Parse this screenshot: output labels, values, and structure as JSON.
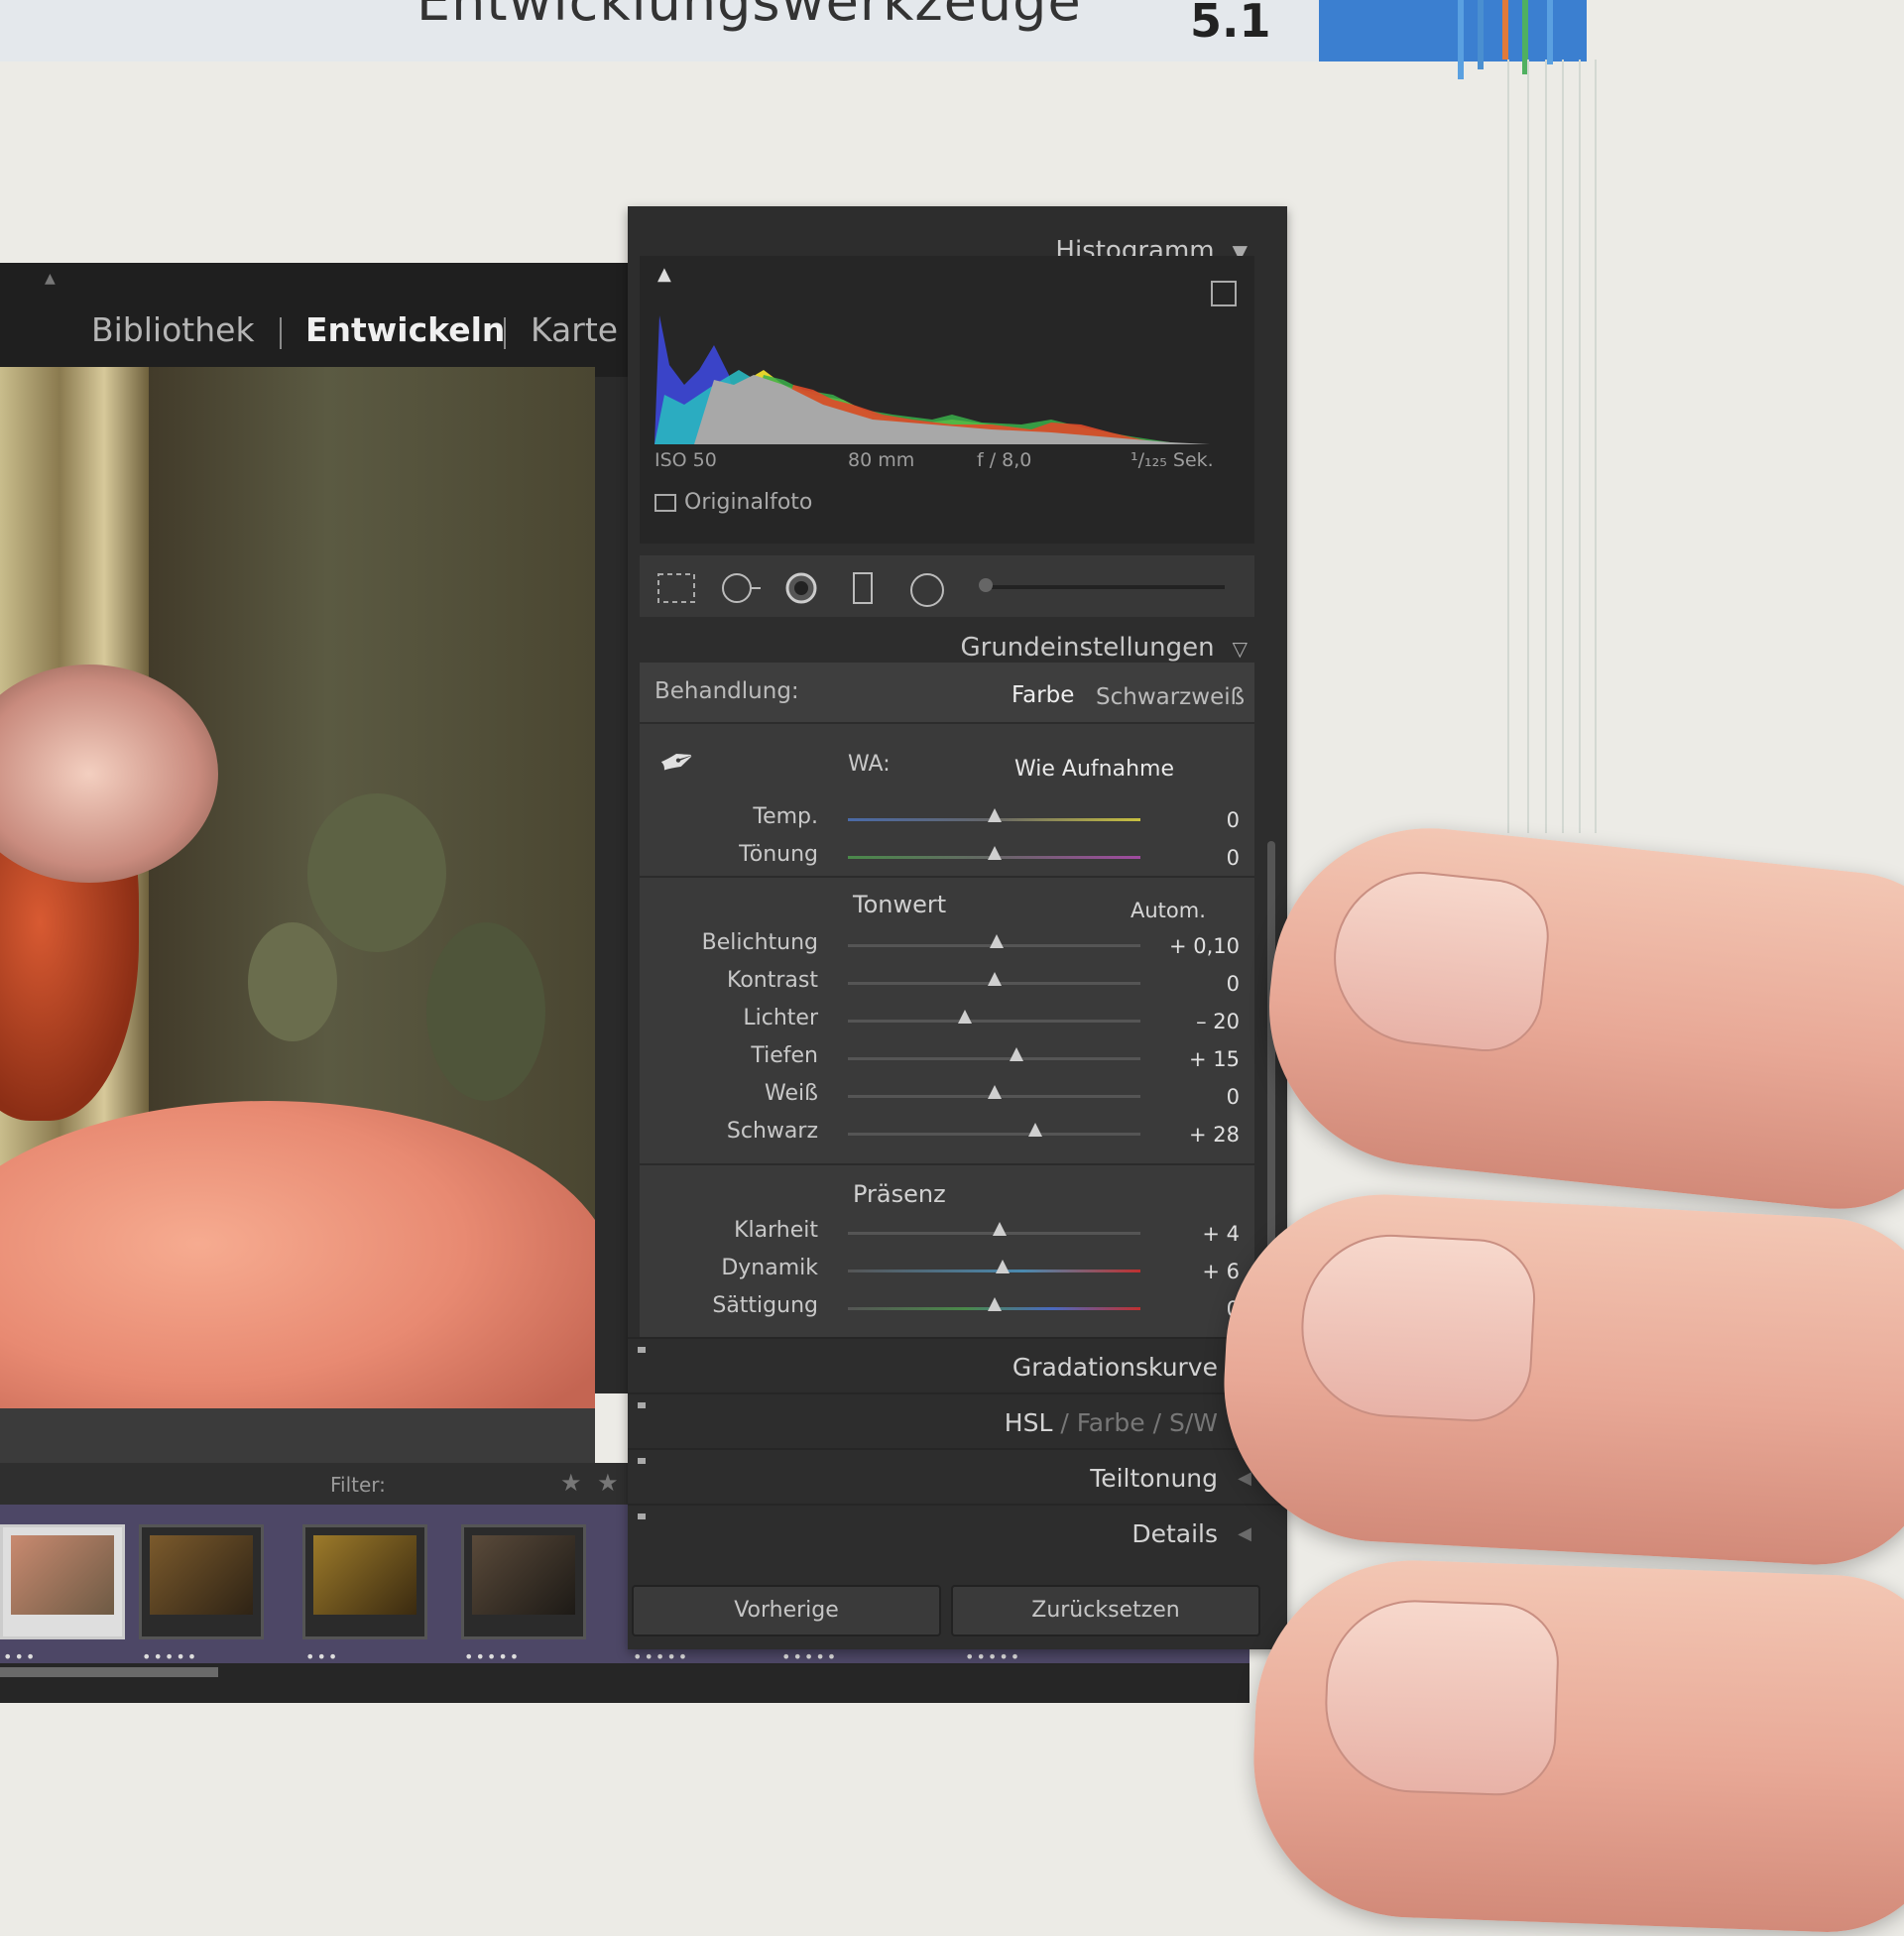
{
  "book": {
    "chapter_title": "Entwicklungswerkzeuge",
    "chapter_number": "5.1"
  },
  "module_tabs": [
    {
      "label": "Bibliothek",
      "active": false
    },
    {
      "label": "Entwickeln",
      "active": true
    },
    {
      "label": "Karte",
      "active": false
    }
  ],
  "filter": {
    "label": "Filter:",
    "stars": "★ ★"
  },
  "filmstrip": {
    "ratings": [
      "•••",
      "•••••",
      "•••",
      "•••••",
      "•••••",
      "•••••",
      "•••••"
    ]
  },
  "histogram": {
    "title": "Histogramm",
    "iso": "ISO 50",
    "focal_length": "80 mm",
    "aperture": "f / 8,0",
    "shutter": "¹/₁₂₅ Sek.",
    "original_label": "Originalfoto"
  },
  "basic": {
    "title": "Grundeinstellungen",
    "treatment_label": "Behandlung:",
    "treatment_color": "Farbe",
    "treatment_bw": "Schwarzweiß",
    "wb_label": "WA:",
    "wb_value": "Wie Aufnahme",
    "sliders_wb": [
      {
        "label": "Temp.",
        "value": "0",
        "position": 0.5
      },
      {
        "label": "Tönung",
        "value": "0",
        "position": 0.5
      }
    ],
    "tone_title": "Tonwert",
    "auto_label": "Autom.",
    "sliders_tone": [
      {
        "label": "Belichtung",
        "value": "+ 0,10",
        "position": 0.51
      },
      {
        "label": "Kontrast",
        "value": "0",
        "position": 0.5
      },
      {
        "label": "Lichter",
        "value": "– 20",
        "position": 0.4
      },
      {
        "label": "Tiefen",
        "value": "+ 15",
        "position": 0.575
      },
      {
        "label": "Weiß",
        "value": "0",
        "position": 0.5
      },
      {
        "label": "Schwarz",
        "value": "+ 28",
        "position": 0.64
      }
    ],
    "presence_title": "Präsenz",
    "sliders_presence": [
      {
        "label": "Klarheit",
        "value": "+ 4",
        "position": 0.52
      },
      {
        "label": "Dynamik",
        "value": "+ 6",
        "position": 0.53
      },
      {
        "label": "Sättigung",
        "value": "0",
        "position": 0.5
      }
    ]
  },
  "sections": {
    "tone_curve": "Gradationskurve",
    "hsl": "HSL",
    "hsl_color": "Farbe",
    "hsl_bw": "S/W",
    "split_toning": "Teiltonung",
    "details": "Details"
  },
  "buttons": {
    "previous": "Vorherige",
    "reset": "Zurücksetzen"
  }
}
